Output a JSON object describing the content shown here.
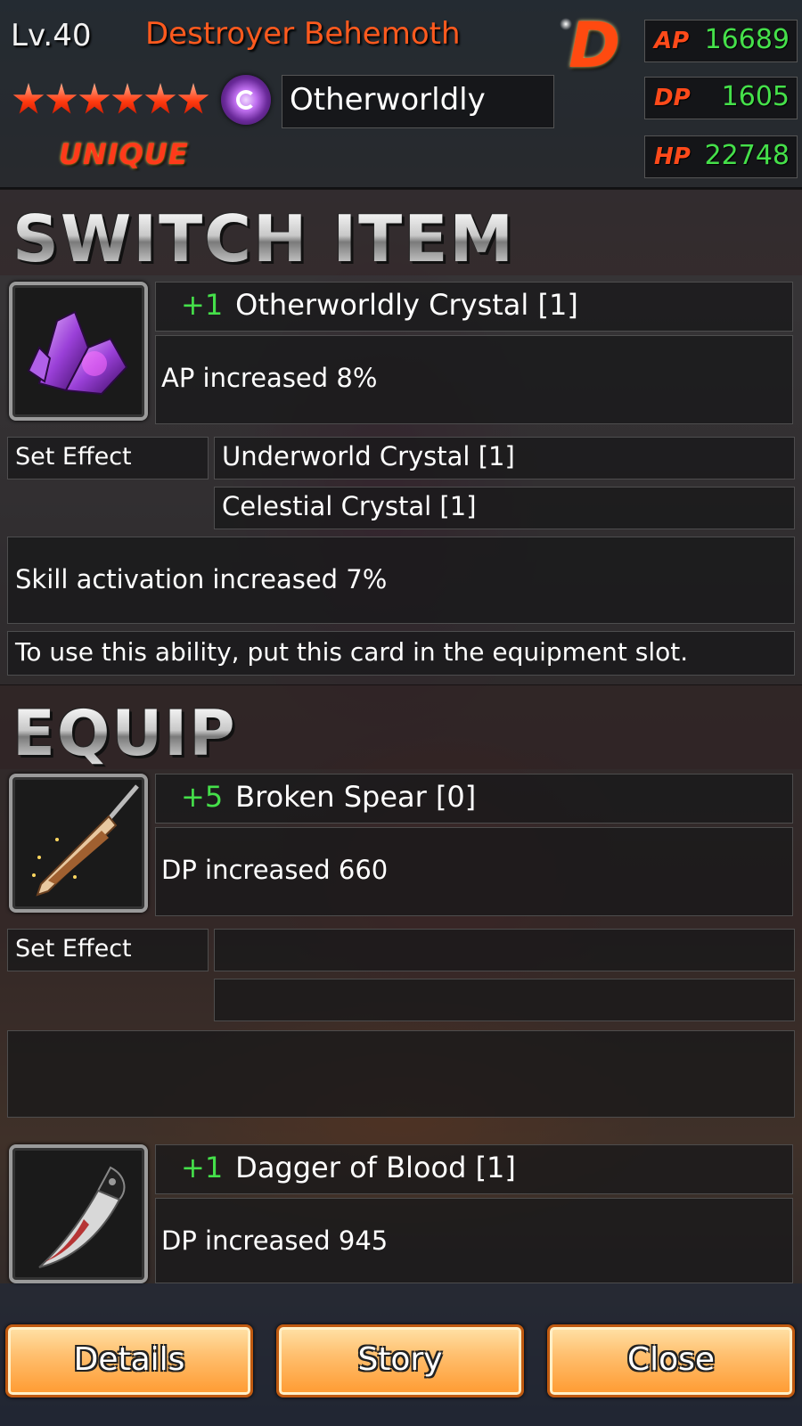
{
  "header": {
    "level": "Lv.40",
    "card_name": "Destroyer Behemoth",
    "stars": 6,
    "rarity": "UNIQUE",
    "attribute": "Otherworldly",
    "grade": "D",
    "stats": [
      {
        "name": "AP",
        "value": "16689"
      },
      {
        "name": "DP",
        "value": "1605"
      },
      {
        "name": "HP",
        "value": "22748"
      }
    ]
  },
  "switch_item": {
    "title": "SWITCH ITEM",
    "item": {
      "plus": "+1",
      "name": "Otherworldly Crystal [1]",
      "effect": "AP increased 8%",
      "icon": "purple-crystal-icon"
    },
    "set_effect_label": "Set Effect",
    "set_items": [
      "Underworld Crystal [1]",
      "Celestial Crystal [1]"
    ],
    "set_bonus": "Skill activation increased 7%",
    "note": "To use this ability, put this card in the equipment slot."
  },
  "equip": {
    "title": "EQUIP",
    "item1": {
      "plus": "+5",
      "name": "Broken Spear [0]",
      "effect": "DP increased 660",
      "icon": "broken-spear-icon"
    },
    "set_effect_label": "Set Effect",
    "item2": {
      "plus": "+1",
      "name": "Dagger of Blood [1]",
      "effect": "DP increased 945",
      "icon": "bloody-dagger-icon"
    }
  },
  "buttons": {
    "details": "Details",
    "story": "Story",
    "close": "Close"
  }
}
